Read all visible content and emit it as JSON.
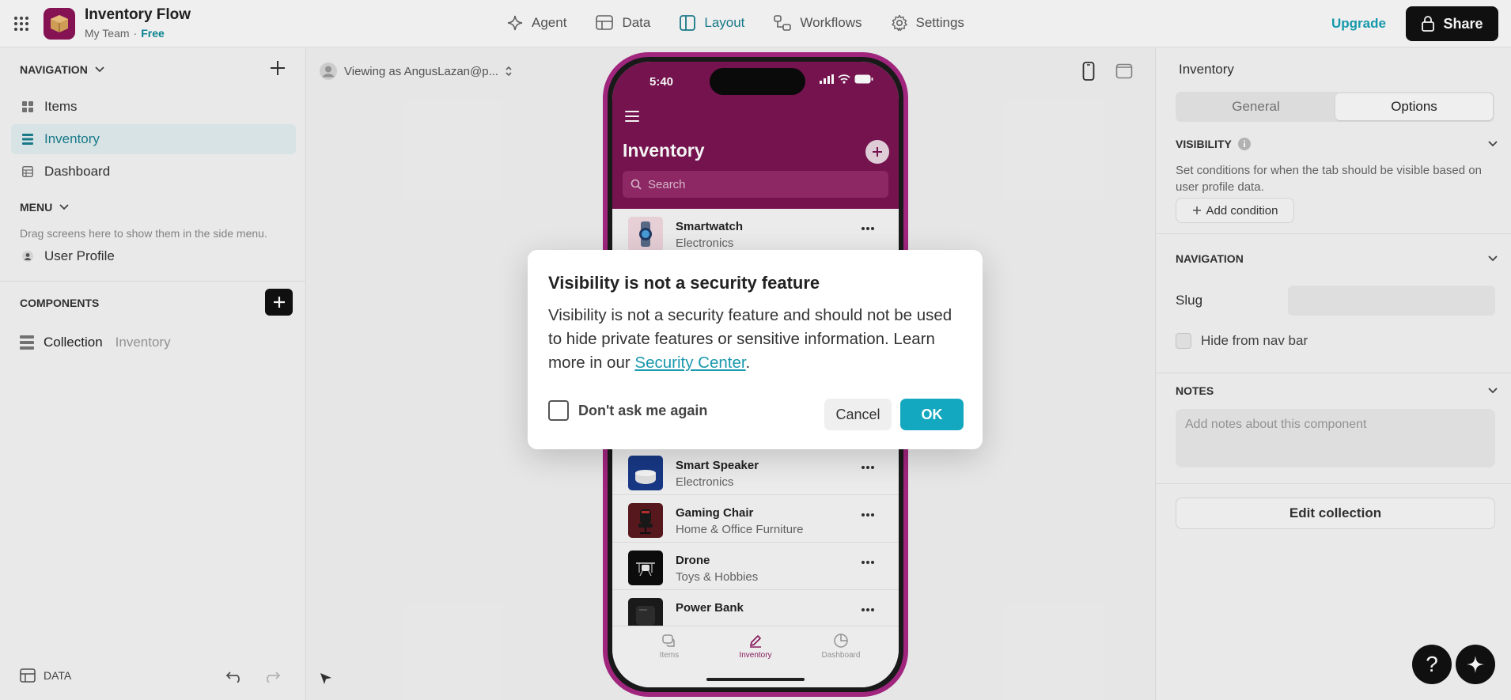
{
  "header": {
    "app_title": "Inventory Flow",
    "team": "My Team",
    "plan": "Free",
    "tabs": [
      {
        "label": "Agent",
        "icon": "sparkle-icon"
      },
      {
        "label": "Data",
        "icon": "table-icon"
      },
      {
        "label": "Layout",
        "icon": "layout-icon",
        "active": true
      },
      {
        "label": "Workflows",
        "icon": "workflows-icon"
      },
      {
        "label": "Settings",
        "icon": "gear-icon"
      }
    ],
    "upgrade": "Upgrade",
    "share": "Share"
  },
  "sidebar": {
    "navigation_heading": "NAVIGATION",
    "nav_items": [
      {
        "label": "Items",
        "icon": "grid-icon"
      },
      {
        "label": "Inventory",
        "icon": "list-icon",
        "active": true
      },
      {
        "label": "Dashboard",
        "icon": "table-icon"
      }
    ],
    "menu_heading": "MENU",
    "menu_hint": "Drag screens here to show them in the side menu.",
    "user_profile": "User Profile",
    "components_heading": "COMPONENTS",
    "component": {
      "label": "Collection",
      "source": "Inventory"
    },
    "data_label": "DATA"
  },
  "canvas": {
    "viewing_as": "Viewing as AngusLazan@p..."
  },
  "phone": {
    "time": "5:40",
    "title": "Inventory",
    "search_placeholder": "Search",
    "items": [
      {
        "name": "Smartwatch",
        "category": "Electronics"
      },
      {
        "name": "Smart Speaker",
        "category": "Electronics"
      },
      {
        "name": "Gaming Chair",
        "category": "Home & Office Furniture"
      },
      {
        "name": "Drone",
        "category": "Toys & Hobbies"
      },
      {
        "name": "Power Bank",
        "category": ""
      }
    ],
    "tabs": [
      {
        "label": "Items"
      },
      {
        "label": "Inventory",
        "active": true
      },
      {
        "label": "Dashboard"
      }
    ]
  },
  "dialog": {
    "title": "Visibility is not a security feature",
    "body": "Visibility is not a security feature and should not be used to hide private features or sensitive information. Learn more in our ",
    "link": "Security Center",
    "body_end": ".",
    "checkbox_label": "Don't ask me again",
    "cancel": "Cancel",
    "ok": "OK"
  },
  "right_panel": {
    "title": "Inventory",
    "segments": [
      "General",
      "Options"
    ],
    "active_segment": "Options",
    "visibility_heading": "VISIBILITY",
    "visibility_desc": "Set conditions for when the tab should be visible based on user profile data.",
    "add_condition": "Add condition",
    "navigation_heading": "NAVIGATION",
    "slug_label": "Slug",
    "hide_from_nav": "Hide from nav bar",
    "notes_heading": "NOTES",
    "notes_placeholder": "Add notes about this component",
    "edit_collection": "Edit collection"
  },
  "colors": {
    "accent": "#13a8bf",
    "brand": "#7a1452",
    "phone_frame": "#a82783"
  }
}
